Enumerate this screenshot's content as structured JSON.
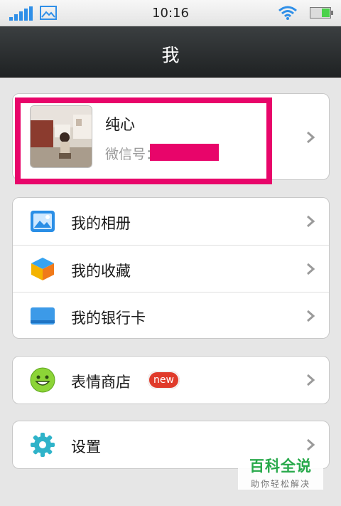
{
  "status_bar": {
    "time": "10:16",
    "icons": [
      "signal-icon",
      "image-icon",
      "wifi-icon",
      "battery-icon"
    ]
  },
  "header": {
    "title": "我"
  },
  "profile": {
    "name": "纯心",
    "wechat_id_label": "微信号："
  },
  "menu_group_1": [
    {
      "label": "我的相册",
      "icon": "photo-album-icon"
    },
    {
      "label": "我的收藏",
      "icon": "favorites-box-icon"
    },
    {
      "label": "我的银行卡",
      "icon": "bank-card-icon"
    }
  ],
  "menu_group_2": [
    {
      "label": "表情商店",
      "icon": "smiley-icon",
      "badge": "new"
    }
  ],
  "menu_group_3": [
    {
      "label": "设置",
      "icon": "gear-icon"
    }
  ],
  "watermark": {
    "line1": "百科全说",
    "line2": "助你轻松解决"
  },
  "colors": {
    "highlight": "#e8056a",
    "badge": "#e03a2a",
    "accent": "#2f8fe8"
  }
}
